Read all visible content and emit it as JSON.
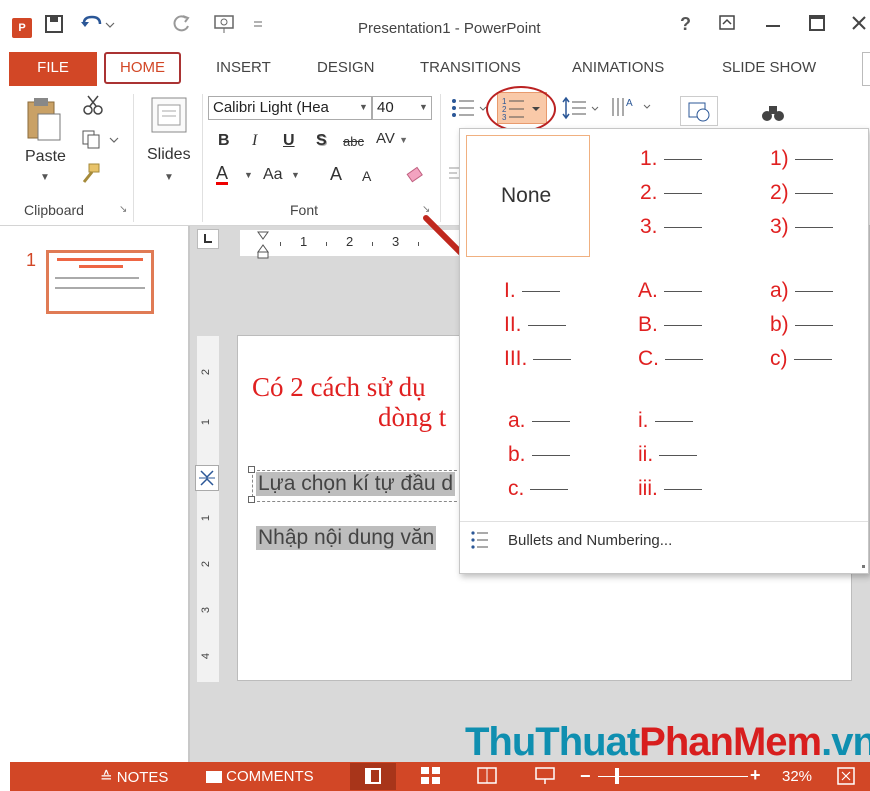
{
  "app": {
    "logo": "P",
    "title": "Presentation1 - PowerPoint",
    "help": "?",
    "window_buttons": [
      "restore-icon",
      "minimize-icon",
      "maximize-icon",
      "close-icon"
    ]
  },
  "tabs": {
    "file": "FILE",
    "items": [
      "HOME",
      "INSERT",
      "DESIGN",
      "TRANSITIONS",
      "ANIMATIONS",
      "SLIDE SHOW"
    ],
    "active": "HOME"
  },
  "ribbon": {
    "clipboard": {
      "paste": "Paste",
      "label": "Clipboard"
    },
    "slides": {
      "label": "Slides"
    },
    "font": {
      "name": "Calibri Light (Hea",
      "size": "40",
      "bold": "B",
      "italic": "I",
      "underline": "U",
      "shadow": "S",
      "strike": "abc",
      "spacing": "AV",
      "color": "A",
      "case": "Aa",
      "grow": "A",
      "shrink": "A",
      "label": "Font"
    }
  },
  "thumbnails": [
    {
      "number": "1"
    }
  ],
  "ruler": {
    "marks": [
      "1",
      "2",
      "3"
    ],
    "vmarks": [
      "2",
      "1",
      "1",
      "2",
      "3",
      "4"
    ]
  },
  "slide": {
    "title_line1": "Có 2 cách sử dụ",
    "title_line2": "dòng t",
    "bullet1": "Lựa chọn kí tự đầu d",
    "bullet2": "Nhập nội dung văn"
  },
  "numbering_menu": {
    "none_label": "None",
    "row1_col2": [
      "1.",
      "2.",
      "3."
    ],
    "row1_col3": [
      "1)",
      "2)",
      "3)"
    ],
    "row2_col1": [
      "I.",
      "II.",
      "III."
    ],
    "row2_col2": [
      "A.",
      "B.",
      "C."
    ],
    "row2_col3": [
      "a)",
      "b)",
      "c)"
    ],
    "row3_col1": [
      "a.",
      "b.",
      "c."
    ],
    "row3_col2": [
      "i.",
      "ii.",
      "iii."
    ],
    "footer": "Bullets and Numbering..."
  },
  "status": {
    "notes": "NOTES",
    "comments": "COMMENTS",
    "zoom": "32%"
  },
  "watermark": {
    "part1": "ThuThuat",
    "part2": "PhanMem",
    "part3": ".vn"
  },
  "colors": {
    "accent": "#d24726",
    "number_red": "#e02020",
    "watermark_teal": "#0f8fb0",
    "watermark_red": "#d81e1e"
  }
}
